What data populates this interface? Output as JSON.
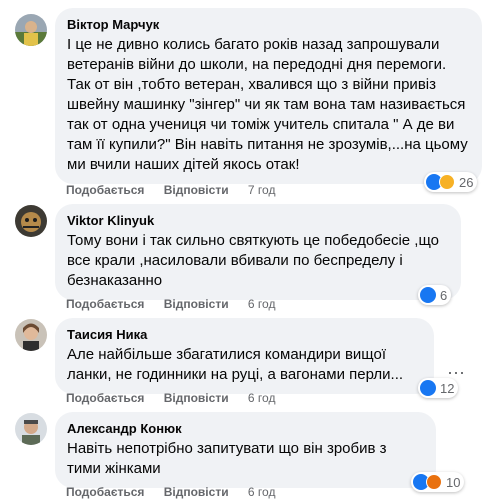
{
  "actions": {
    "like_label": "Подобається",
    "reply_label": "Відповісти"
  },
  "comments": [
    {
      "author": "Віктор Марчук",
      "text": "І це не дивно колись багато років назад запрошували ветеранів війни до школи, на передодні дня перемоги. Так от він ,тобто ветеран, хвалився що з війни привіз швейну машинку \"зінгер\" чи як там вона там називається так от одна учениця чи томіж учитель спитала \" А де ви там її купили?\" Він навіть питання не зрозумів,...на цьому ми вчили наших дітей якось отак!",
      "time": "7 год",
      "reaction_count": "26",
      "reactions": [
        "like-icon",
        "sad-icon"
      ]
    },
    {
      "author": "Viktor Klinyuk",
      "text": "Тому вони і так сильно святкують це победобесіе ,що все крали ,насиловали вбивали по беспределу і безнаказанно",
      "time": "6 год",
      "reaction_count": "6",
      "reactions": [
        "like-icon"
      ]
    },
    {
      "author": "Таисия Ника",
      "text": "Але найбільше збагатилися командири вищої ланки, не годинники на руці, а вагонами перли...",
      "time": "6 год",
      "reaction_count": "12",
      "reactions": [
        "like-icon"
      ]
    },
    {
      "author": "Александр Конюк",
      "text": "Навіть непотрібно запитувати що він зробив з тими жінками",
      "time": "6 год",
      "reaction_count": "10",
      "reactions": [
        "like-icon",
        "angry-icon"
      ]
    }
  ],
  "colors": {
    "bubble": "#f0f2f5",
    "like": "#1877f2",
    "sad": "#f7b125",
    "angry": "#e9710f",
    "secondary_text": "#65676b"
  }
}
